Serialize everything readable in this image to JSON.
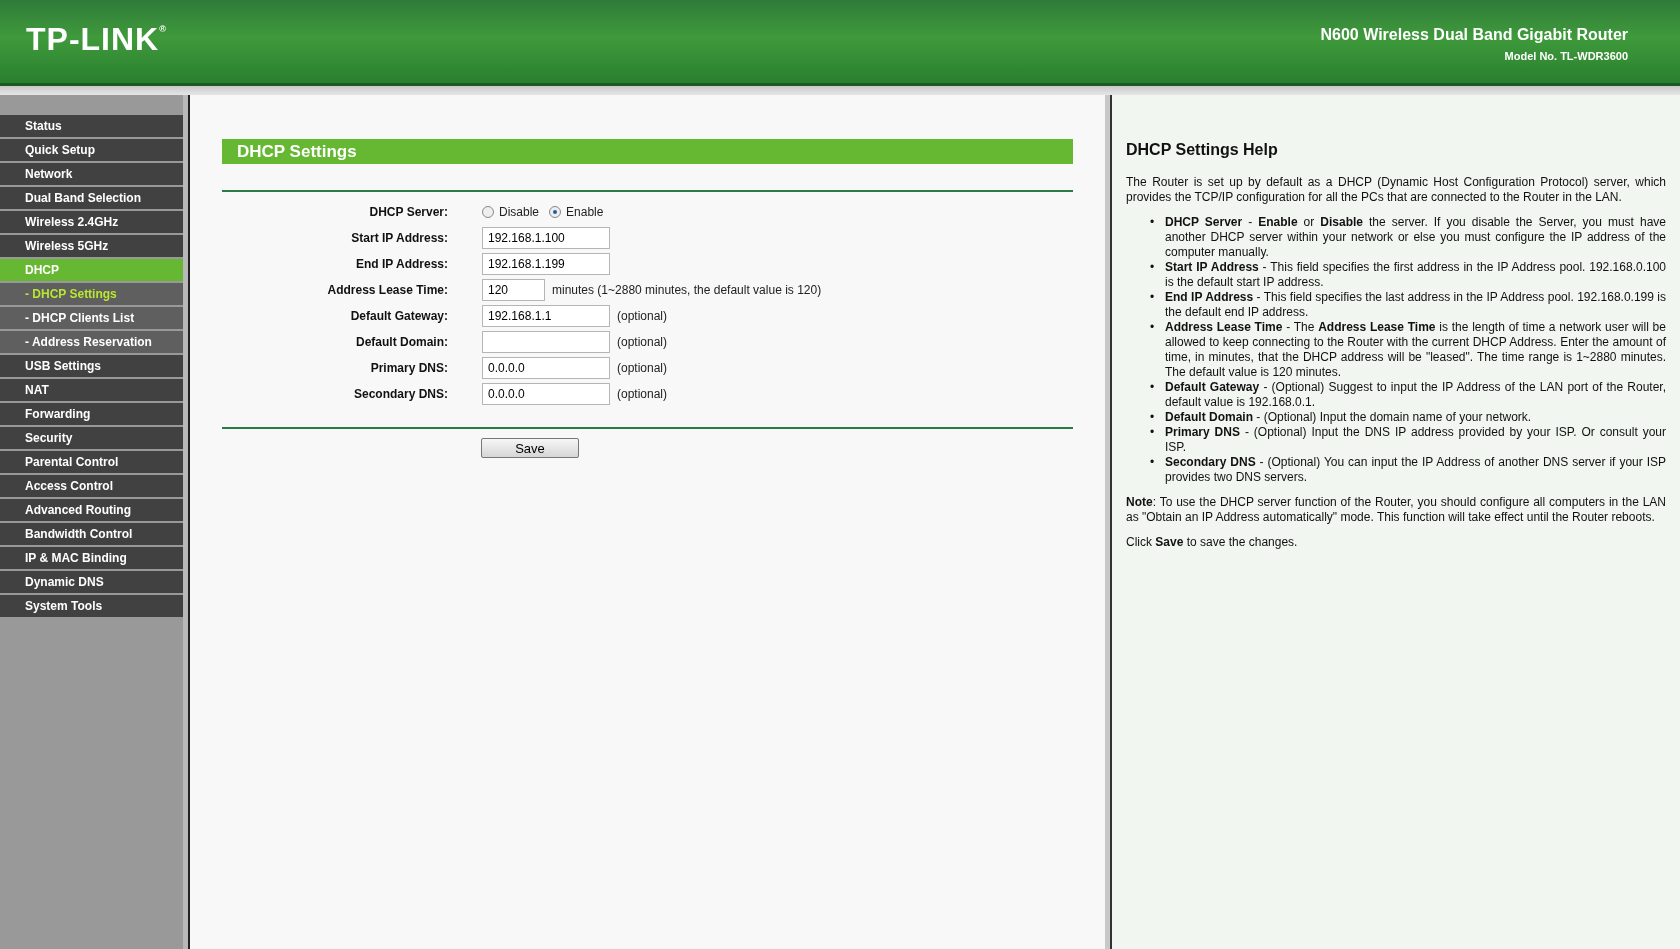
{
  "header": {
    "logo": "TP-LINK$^{®}$",
    "product": "N600 Wireless Dual Band Gigabit Router",
    "model": "Model No. TL-WDR3600"
  },
  "sidebar": {
    "items": [
      {
        "label": "Status",
        "kind": "menu",
        "selected": false
      },
      {
        "label": "Quick Setup",
        "kind": "menu",
        "selected": false
      },
      {
        "label": "Network",
        "kind": "menu",
        "selected": false
      },
      {
        "label": "Dual Band Selection",
        "kind": "menu",
        "selected": false
      },
      {
        "label": "Wireless 2.4GHz",
        "kind": "menu",
        "selected": false
      },
      {
        "label": "Wireless 5GHz",
        "kind": "menu",
        "selected": false
      },
      {
        "label": "DHCP",
        "kind": "menu",
        "selected": true
      },
      {
        "label": "- DHCP Settings",
        "kind": "sub",
        "selected": true
      },
      {
        "label": "- DHCP Clients List",
        "kind": "sub",
        "selected": false
      },
      {
        "label": "- Address Reservation",
        "kind": "sub",
        "selected": false
      },
      {
        "label": "USB Settings",
        "kind": "menu",
        "selected": false
      },
      {
        "label": "NAT",
        "kind": "menu",
        "selected": false
      },
      {
        "label": "Forwarding",
        "kind": "menu",
        "selected": false
      },
      {
        "label": "Security",
        "kind": "menu",
        "selected": false
      },
      {
        "label": "Parental Control",
        "kind": "menu",
        "selected": false
      },
      {
        "label": "Access Control",
        "kind": "menu",
        "selected": false
      },
      {
        "label": "Advanced Routing",
        "kind": "menu",
        "selected": false
      },
      {
        "label": "Bandwidth Control",
        "kind": "menu",
        "selected": false
      },
      {
        "label": "IP & MAC Binding",
        "kind": "menu",
        "selected": false
      },
      {
        "label": "Dynamic DNS",
        "kind": "menu",
        "selected": false
      },
      {
        "label": "System Tools",
        "kind": "menu",
        "selected": false
      }
    ]
  },
  "form": {
    "title": "DHCP Settings",
    "rows": [
      {
        "label": "DHCP Server:",
        "kind": "radio",
        "options": [
          {
            "label": "Disable",
            "selected": false
          },
          {
            "label": "Enable",
            "selected": true
          }
        ]
      },
      {
        "label": "Start IP Address:",
        "kind": "input",
        "value": "192.168.1.100"
      },
      {
        "label": "End IP Address:",
        "kind": "input",
        "value": "192.168.1.199"
      },
      {
        "label": "Address Lease Time:",
        "kind": "short-input",
        "value": "120",
        "note": "minutes (1~2880 minutes, the default value is 120)"
      },
      {
        "label": "Default Gateway:",
        "kind": "input",
        "value": "192.168.1.1",
        "note": "(optional)"
      },
      {
        "label": "Default Domain:",
        "kind": "input",
        "note": "(optional)"
      },
      {
        "label": "Primary DNS:",
        "kind": "input",
        "value": "0.0.0.0",
        "note": "(optional)"
      },
      {
        "label": "Secondary DNS:",
        "kind": "input",
        "value": "0.0.0.0",
        "note": "(optional)"
      }
    ],
    "save_button": "Save"
  },
  "help": {
    "title": "DHCP Settings Help",
    "intro": "The Router is set up by default as a DHCP (Dynamic Host Configuration Protocol) server, which provides the TCP/IP configuration for all the PCs that are connected to the Router in the LAN.",
    "bullet": "•",
    "items": [
      "**DHCP Server** - **Enable** or **Disable** the server. If you disable the Server, you must have another DHCP server within your network or else you must configure the IP address of the computer manually.",
      "**Start IP Address** - This field specifies the first address in the IP Address pool. 192.168.0.100 is the default start IP address.",
      "**End IP Address** - This field specifies the last address in the IP Address pool. 192.168.0.199 is the default end IP address.",
      "**Address Lease Time** - The **Address Lease Time** is the length of time a network user will be allowed to keep connecting to the Router with the current DHCP Address. Enter the amount of time, in minutes, that the DHCP address will be \"leased\". The time range is 1~2880 minutes. The default value is 120 minutes.",
      "**Default Gateway** - (Optional) Suggest to input the IP Address of the LAN port of the Router, default value is 192.168.0.1.",
      "**Default Domain** - (Optional) Input the domain name of your network.",
      "**Primary DNS** - (Optional) Input the DNS IP address provided by your ISP. Or consult your ISP.",
      "**Secondary DNS** - (Optional) You can input the IP Address of another DNS server if your ISP provides two DNS servers."
    ],
    "note": "**Note**: To use the DHCP server function of the Router, you should configure all computers in the LAN as \"Obtain an IP Address automatically\" mode. This function will take effect until the Router reboots.",
    "footer": "Click **Save** to save the changes."
  }
}
